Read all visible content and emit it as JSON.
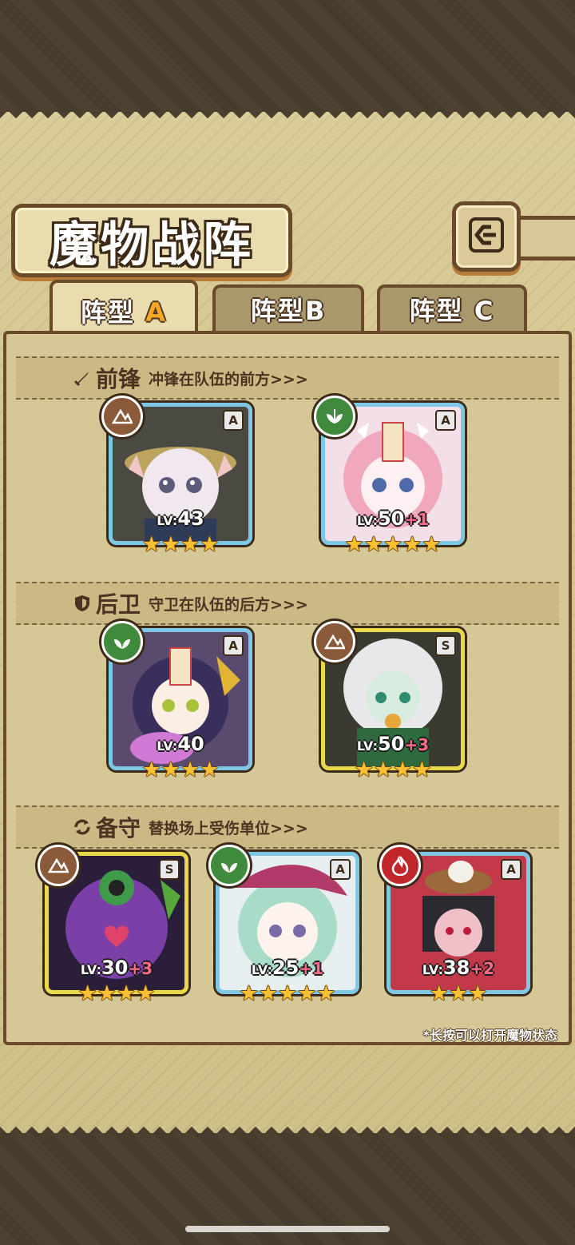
{
  "title": "魔物战阵",
  "tabs": [
    {
      "prefix": "阵型",
      "letter": "A"
    },
    {
      "prefix": "阵型",
      "letter": "B"
    },
    {
      "prefix": "阵型",
      "letter": "C"
    }
  ],
  "sections": [
    {
      "title": "前锋",
      "desc": "冲锋在队伍的前方>>>",
      "icon": "sword-icon"
    },
    {
      "title": "后卫",
      "desc": "守卫在队伍的后方>>>",
      "icon": "shield-icon"
    },
    {
      "title": "备守",
      "desc": "替换场上受伤单位>>>",
      "icon": "swap-icon"
    }
  ],
  "units": {
    "front": [
      {
        "lv_label": "LV:",
        "lv": "43",
        "plus": "",
        "rank": "A",
        "element": "earth",
        "stars": "★★★★"
      },
      {
        "lv_label": "LV:",
        "lv": "50",
        "plus": "+1",
        "rank": "A",
        "element": "wood",
        "stars": "★★★★★"
      }
    ],
    "back": [
      {
        "lv_label": "LV:",
        "lv": "40",
        "plus": "",
        "rank": "A",
        "element": "wood",
        "stars": "★★★★"
      },
      {
        "lv_label": "LV:",
        "lv": "50",
        "plus": "+3",
        "rank": "S",
        "element": "earth",
        "stars": "★★★★"
      }
    ],
    "reserve": [
      {
        "lv_label": "LV:",
        "lv": "30",
        "plus": "+3",
        "rank": "S",
        "element": "earth",
        "stars": "★★★★"
      },
      {
        "lv_label": "LV:",
        "lv": "25",
        "plus": "+1",
        "rank": "A",
        "element": "wood",
        "stars": "★★★★★"
      },
      {
        "lv_label": "LV:",
        "lv": "38",
        "plus": "+2",
        "rank": "A",
        "element": "fire",
        "stars": "★★★"
      }
    ]
  },
  "hint": "*长按可以打开魔物状态",
  "colors": {
    "accent": "#f6a623",
    "frame_blue": "#7cc7e6",
    "frame_gold": "#e8d84a"
  }
}
